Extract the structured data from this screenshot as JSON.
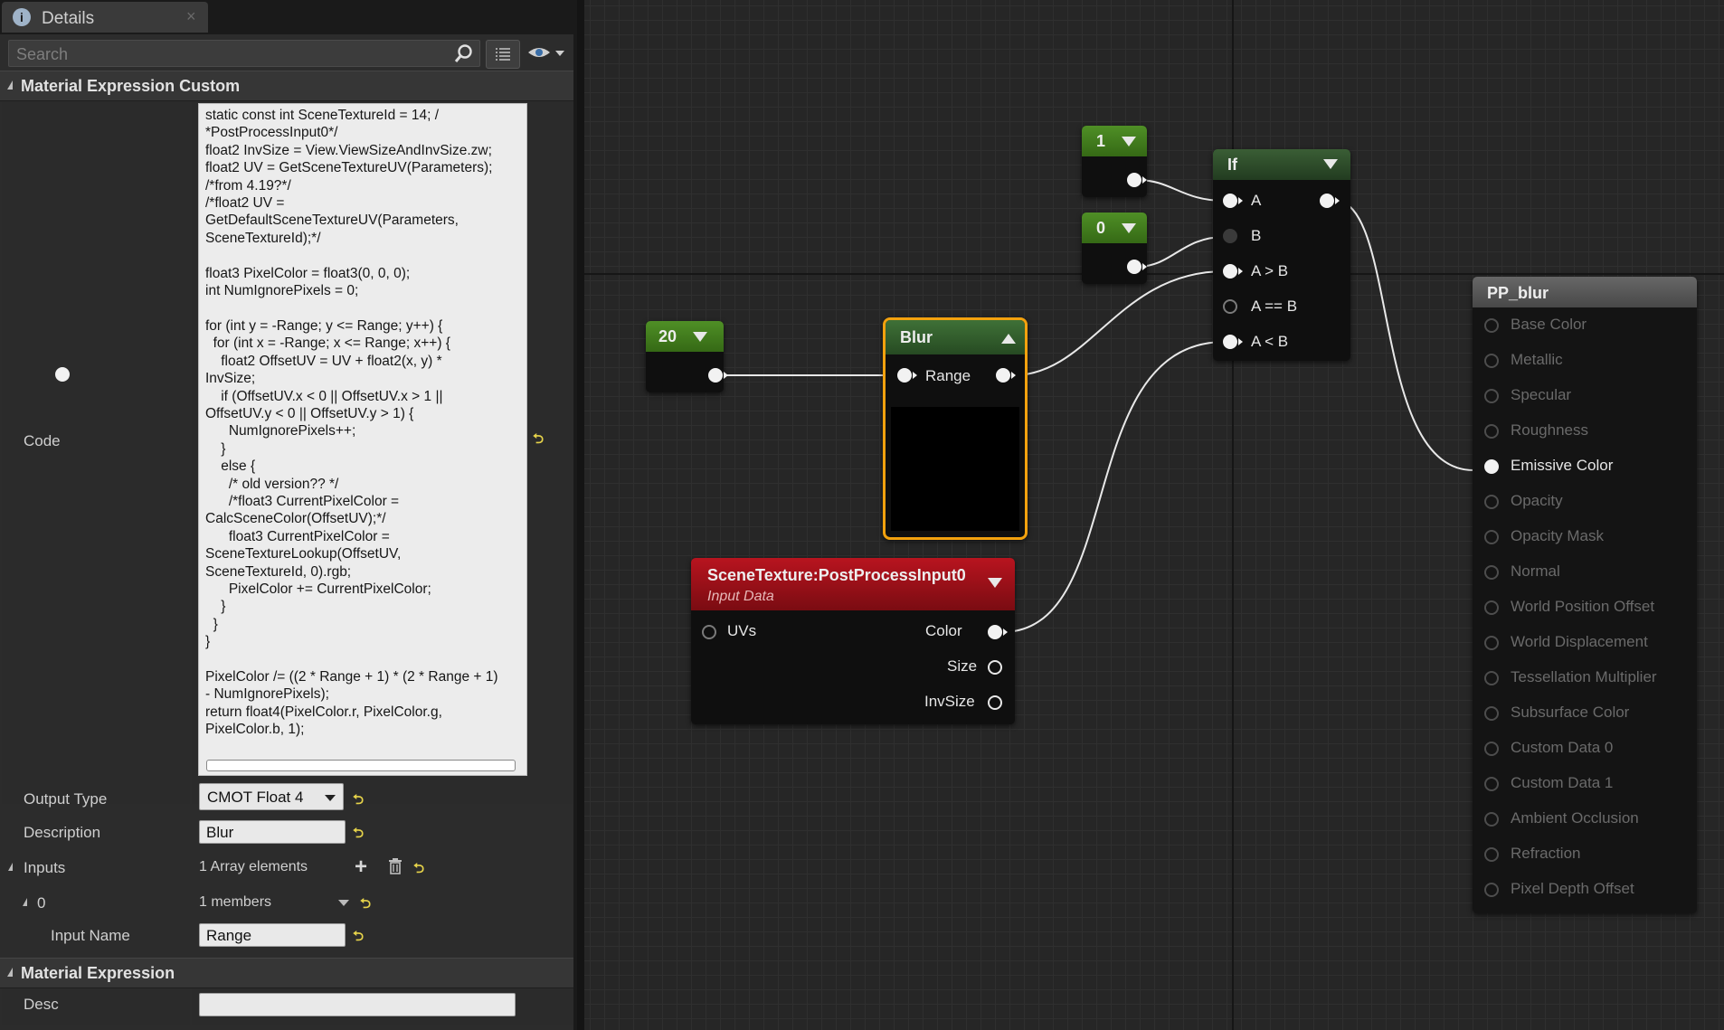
{
  "details": {
    "tab_title": "Details",
    "tab_icon": "i",
    "search_placeholder": "Search",
    "category_custom": "Material Expression Custom",
    "category_expression": "Material Expression",
    "props": {
      "code_label": "Code",
      "code": "static const int SceneTextureId = 14; /\n*PostProcessInput0*/\nfloat2 InvSize = View.ViewSizeAndInvSize.zw;\nfloat2 UV = GetSceneTextureUV(Parameters);\n/*from 4.19?*/\n/*float2 UV =\nGetDefaultSceneTextureUV(Parameters,\nSceneTextureId);*/\n\nfloat3 PixelColor = float3(0, 0, 0);\nint NumIgnorePixels = 0;\n\nfor (int y = -Range; y <= Range; y++) {\n  for (int x = -Range; x <= Range; x++) {\n    float2 OffsetUV = UV + float2(x, y) *\nInvSize;\n    if (OffsetUV.x < 0 || OffsetUV.x > 1 ||\nOffsetUV.y < 0 || OffsetUV.y > 1) {\n      NumIgnorePixels++;\n    }\n    else {\n      /* old version?? */\n      /*float3 CurrentPixelColor =\nCalcSceneColor(OffsetUV);*/\n      float3 CurrentPixelColor =\nSceneTextureLookup(OffsetUV,\nSceneTextureId, 0).rgb;\n      PixelColor += CurrentPixelColor;\n    }\n  }\n}\n\nPixelColor /= ((2 * Range + 1) * (2 * Range + 1)\n- NumIgnorePixels);\nreturn float4(PixelColor.r, PixelColor.g,\nPixelColor.b, 1);",
      "output_type_label": "Output Type",
      "output_type_value": "CMOT Float 4",
      "description_label": "Description",
      "description_value": "Blur",
      "inputs_label": "Inputs",
      "inputs_value": "1 Array elements",
      "input0_label": "0",
      "input0_value": "1 members",
      "input_name_label": "Input Name",
      "input_name_value": "Range",
      "desc_label": "Desc",
      "desc_value": ""
    }
  },
  "graph": {
    "const_20": "20",
    "const_1": "1",
    "const_0": "0",
    "blur_title": "Blur",
    "blur_pin_range": "Range",
    "if_title": "If",
    "if_pins": [
      "A",
      "B",
      "A > B",
      "A == B",
      "A < B"
    ],
    "scenetex_title": "SceneTexture:PostProcessInput0",
    "scenetex_subtitle": "Input Data",
    "scenetex_in_uvs": "UVs",
    "scenetex_out": [
      "Color",
      "Size",
      "InvSize"
    ],
    "result_title": "PP_blur",
    "result_pins": [
      "Base Color",
      "Metallic",
      "Specular",
      "Roughness",
      "Emissive Color",
      "Opacity",
      "Opacity Mask",
      "Normal",
      "World Position Offset",
      "World Displacement",
      "Tessellation Multiplier",
      "Subsurface Color",
      "Custom Data 0",
      "Custom Data 1",
      "Ambient Occlusion",
      "Refraction",
      "Pixel Depth Offset"
    ],
    "colors": {
      "const_header": "#3f7a1c",
      "if_header": "#2e4e2a",
      "blur_header": "#2f5a2a",
      "blur_selected_border": "#f2a10e",
      "scenetex_header": "#a3121c",
      "result_header": "#575757"
    }
  }
}
